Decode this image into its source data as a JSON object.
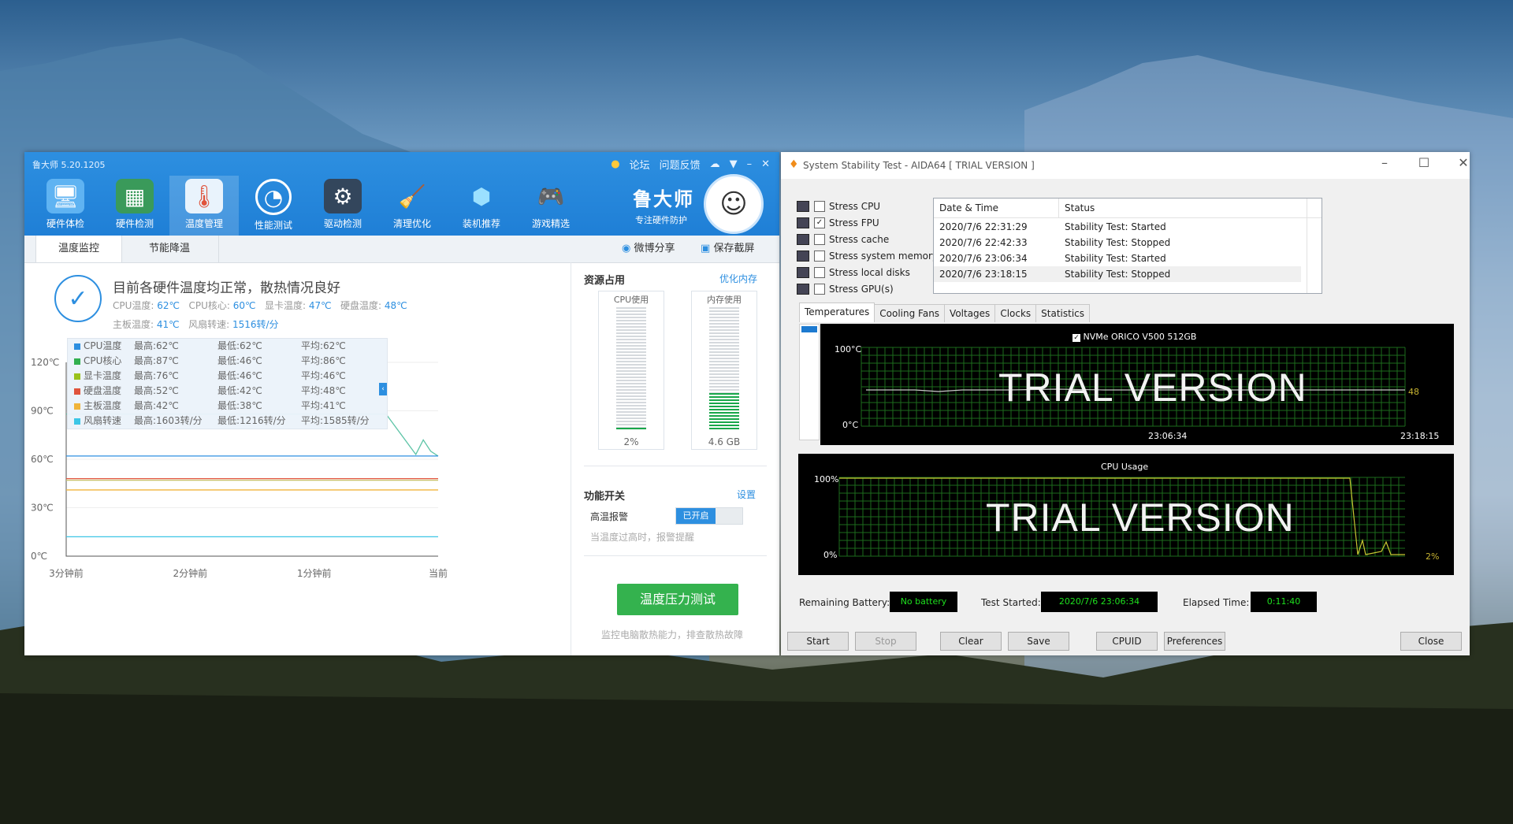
{
  "ludashi": {
    "title": "鲁大师 5.20.1205",
    "topbar": {
      "forum": "论坛",
      "feedback": "问题反馈"
    },
    "nav": [
      {
        "label": "硬件体检",
        "icon": "monitor-icon"
      },
      {
        "label": "硬件检测",
        "icon": "board-icon"
      },
      {
        "label": "温度管理",
        "icon": "thermometer-icon"
      },
      {
        "label": "性能测试",
        "icon": "speedometer-icon"
      },
      {
        "label": "驱动检测",
        "icon": "gear-icon"
      },
      {
        "label": "清理优化",
        "icon": "broom-icon"
      },
      {
        "label": "装机推荐",
        "icon": "cube-icon"
      },
      {
        "label": "游戏精选",
        "icon": "gamepad-icon"
      }
    ],
    "brand": {
      "name": "鲁大师",
      "slogan": "专注硬件防护"
    },
    "tabs": {
      "temp_monitor": "温度监控",
      "power_save": "节能降温",
      "weibo_share": "微博分享",
      "save_screenshot": "保存截屏"
    },
    "status_msg": "目前各硬件温度均正常，散热情况良好",
    "temps": {
      "cpu_label": "CPU温度:",
      "cpu_value": "62℃",
      "cpu_core_label": "CPU核心:",
      "cpu_core_value": "60℃",
      "gpu_label": "显卡温度:",
      "gpu_value": "47℃",
      "disk_label": "硬盘温度:",
      "disk_value": "48℃",
      "board_label": "主板温度:",
      "board_value": "41℃",
      "fan_label": "风扇转速:",
      "fan_value": "1516转/分"
    },
    "legend": [
      {
        "name": "CPU温度",
        "max": "最高:62℃",
        "min": "最低:62℃",
        "avg": "平均:62℃",
        "color": "#2d8fe0"
      },
      {
        "name": "CPU核心",
        "max": "最高:87℃",
        "min": "最低:46℃",
        "avg": "平均:86℃",
        "color": "#32b04f"
      },
      {
        "name": "显卡温度",
        "max": "最高:76℃",
        "min": "最低:46℃",
        "avg": "平均:46℃",
        "color": "#99c21c"
      },
      {
        "name": "硬盘温度",
        "max": "最高:52℃",
        "min": "最低:42℃",
        "avg": "平均:48℃",
        "color": "#e0533c"
      },
      {
        "name": "主板温度",
        "max": "最高:42℃",
        "min": "最低:38℃",
        "avg": "平均:41℃",
        "color": "#f0b43a"
      },
      {
        "name": "风扇转速",
        "max": "最高:1603转/分",
        "min": "最低:1216转/分",
        "avg": "平均:1585转/分",
        "color": "#3cc6e6"
      }
    ],
    "chart_data": {
      "type": "line",
      "y_ticks": [
        "120℃",
        "90℃",
        "60℃",
        "30℃",
        "0℃"
      ],
      "ylim": [
        0,
        120
      ],
      "x_ticks": [
        "3分钟前",
        "2分钟前",
        "1分钟前",
        "当前"
      ],
      "series": [
        {
          "name": "CPU核心",
          "color": "#5ec4a7",
          "x": [
            0,
            0.86,
            0.94,
            0.96,
            0.98,
            1.0
          ],
          "values": [
            88,
            88,
            63,
            72,
            65,
            62
          ]
        },
        {
          "name": "CPU温度",
          "color": "#2d8fe0",
          "x": [
            0,
            1.0
          ],
          "values": [
            62,
            62
          ]
        },
        {
          "name": "硬盘温度",
          "color": "#e0533c",
          "x": [
            0,
            1.0
          ],
          "values": [
            48,
            48
          ]
        },
        {
          "name": "主板温度",
          "color": "#f0b43a",
          "x": [
            0,
            1.0
          ],
          "values": [
            41,
            41
          ]
        },
        {
          "name": "显卡温度",
          "color": "#c9c36a",
          "x": [
            0,
            1.0
          ],
          "values": [
            47,
            47
          ]
        },
        {
          "name": "风扇转速",
          "color": "#3cc6e6",
          "x": [
            0,
            1.0
          ],
          "values": [
            12,
            12
          ]
        }
      ]
    },
    "resources": {
      "title": "资源占用",
      "optimize": "优化内存",
      "cpu_label": "CPU使用",
      "cpu_value": "2%",
      "cpu_percent": 2,
      "mem_label": "内存使用",
      "mem_value": "4.6 GB",
      "mem_percent": 30
    },
    "features": {
      "title": "功能开关",
      "settings": "设置",
      "alarm_label": "高温报警",
      "alarm_state": "已开启",
      "alarm_desc": "当温度过高时，报警提醒"
    },
    "stress_button": "温度压力测试",
    "stress_desc": "监控电脑散热能力，排查散热故障"
  },
  "aida": {
    "title": "System Stability Test - AIDA64  [ TRIAL VERSION ]",
    "stress": [
      {
        "label": "Stress CPU",
        "checked": false
      },
      {
        "label": "Stress FPU",
        "checked": true
      },
      {
        "label": "Stress cache",
        "checked": false
      },
      {
        "label": "Stress system memory",
        "checked": false
      },
      {
        "label": "Stress local disks",
        "checked": false
      },
      {
        "label": "Stress GPU(s)",
        "checked": false
      }
    ],
    "log_headers": {
      "date": "Date & Time",
      "status": "Status"
    },
    "log": [
      {
        "date": "2020/7/6 22:31:29",
        "status": "Stability Test: Started"
      },
      {
        "date": "2020/7/6 22:42:33",
        "status": "Stability Test: Stopped"
      },
      {
        "date": "2020/7/6 23:06:34",
        "status": "Stability Test: Started"
      },
      {
        "date": "2020/7/6 23:18:15",
        "status": "Stability Test: Stopped"
      }
    ],
    "tabs": [
      "Temperatures",
      "Cooling Fans",
      "Voltages",
      "Clocks",
      "Statistics"
    ],
    "temp_graph": {
      "legend": "NVMe ORICO V500 512GB",
      "ymax": "100°C",
      "ymin": "0°C",
      "t1": "23:06:34",
      "t2": "23:18:15",
      "current": "48",
      "watermark": "TRIAL VERSION"
    },
    "cpu_graph": {
      "title": "CPU Usage",
      "ymax": "100%",
      "ymin": "0%",
      "current": "2%",
      "watermark": "TRIAL VERSION"
    },
    "info": {
      "battery_label": "Remaining Battery:",
      "battery_value": "No battery",
      "started_label": "Test Started:",
      "started_value": "2020/7/6 23:06:34",
      "elapsed_label": "Elapsed Time:",
      "elapsed_value": "0:11:40"
    },
    "buttons": {
      "start": "Start",
      "stop": "Stop",
      "clear": "Clear",
      "save": "Save",
      "cpuid": "CPUID",
      "preferences": "Preferences",
      "close": "Close"
    }
  }
}
